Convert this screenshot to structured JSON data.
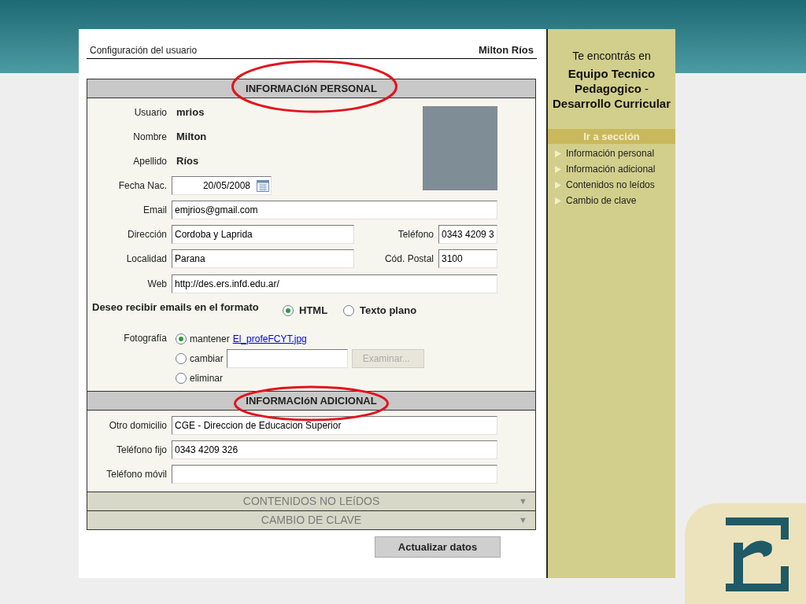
{
  "header": {
    "title": "Configuración del usuario",
    "user": "Milton Ríos"
  },
  "personal": {
    "title": "INFORMACIóN PERSONAL",
    "info": [
      {
        "label": "Usuario",
        "value": "mrios"
      },
      {
        "label": "Nombre",
        "value": "Milton"
      },
      {
        "label": "Apellido",
        "value": "Ríos"
      }
    ],
    "birth": {
      "label": "Fecha Nac.",
      "value": "20/05/2008"
    },
    "email": {
      "label": "Email",
      "value": "emjrios@gmail.com"
    },
    "address_rows": [
      {
        "label": "Dirección",
        "value": "Cordoba y Laprida",
        "label_2": "Teléfono",
        "value_2": "0343 4209 3"
      },
      {
        "label": "Localidad",
        "value": "Parana",
        "label_2": "Cód. Postal",
        "value_2": "3100"
      }
    ],
    "web": {
      "label": "Web",
      "value": "http://des.ers.infd.edu.ar/"
    },
    "format": {
      "label": "Deseo recibir emails en el formato",
      "options": [
        {
          "label": "HTML",
          "selected": true
        },
        {
          "label": "Texto plano",
          "selected": false
        }
      ]
    },
    "photo": {
      "label": "Fotografía",
      "options": [
        {
          "kind": "keep",
          "label": "mantener",
          "selected": true,
          "link": "El_profeFCYT.jpg"
        },
        {
          "kind": "change",
          "label": "cambiar",
          "selected": false,
          "button": {
            "label": "Examinar...",
            "disabled": true
          }
        },
        {
          "kind": "remove",
          "label": "eliminar",
          "selected": false
        }
      ]
    }
  },
  "additional": {
    "title": "INFORMACIóN ADICIONAL",
    "fields": [
      {
        "label": "Otro domicilio",
        "value": "CGE - Direccion de Educacion Superior"
      },
      {
        "label": "Teléfono fijo",
        "value": "0343 4209 326"
      },
      {
        "label": "Teléfono móvil"
      }
    ]
  },
  "collapsed_sections": [
    {
      "title": "CONTENIDOS NO LEíDOS",
      "expanded": false,
      "arrow": "▼"
    },
    {
      "title": "CAMBIO DE CLAVE",
      "expanded": false,
      "arrow": "▼"
    }
  ],
  "submit": "Actualizar datos",
  "sidebar": {
    "intro": "Te encontrás en",
    "group": "**Equipo Tecnico Pedagogico** - **Desarrollo Curricular**",
    "heading": "Ir a sección",
    "links": [
      "Información personal",
      "Información adicional",
      "Contenidos no leídos",
      "Cambio de clave"
    ]
  }
}
